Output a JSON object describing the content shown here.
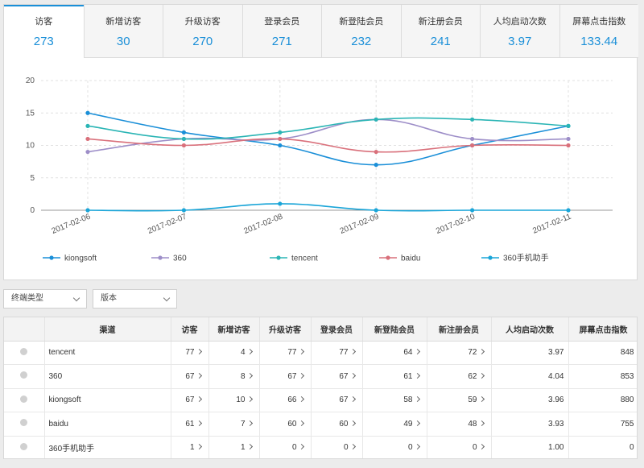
{
  "tabs": [
    {
      "label": "访客",
      "value": "273",
      "active": true
    },
    {
      "label": "新增访客",
      "value": "30"
    },
    {
      "label": "升级访客",
      "value": "270"
    },
    {
      "label": "登录会员",
      "value": "271"
    },
    {
      "label": "新登陆会员",
      "value": "232"
    },
    {
      "label": "新注册会员",
      "value": "241"
    },
    {
      "label": "人均启动次数",
      "value": "3.97"
    },
    {
      "label": "屏幕点击指数",
      "value": "133.44"
    }
  ],
  "chart_data": {
    "type": "line",
    "x": [
      "2017-02-06",
      "2017-02-07",
      "2017-02-08",
      "2017-02-09",
      "2017-02-10",
      "2017-02-11"
    ],
    "ylim": [
      0,
      20
    ],
    "yticks": [
      "0",
      "5",
      "10",
      "15",
      "20"
    ],
    "grid": true,
    "legend_position": "bottom",
    "series": [
      {
        "name": "kiongsoft",
        "color": "#1a8fd8",
        "values": [
          15,
          12,
          10,
          7,
          10,
          13
        ]
      },
      {
        "name": "360",
        "color": "#9d8ec8",
        "values": [
          9,
          11,
          11,
          14,
          11,
          11
        ]
      },
      {
        "name": "tencent",
        "color": "#2bb5b5",
        "values": [
          13,
          11,
          12,
          14,
          14,
          13
        ]
      },
      {
        "name": "baidu",
        "color": "#d9707b",
        "values": [
          11,
          10,
          11,
          9,
          10,
          10
        ]
      },
      {
        "name": "360手机助手",
        "color": "#1aa5d8",
        "values": [
          0,
          0,
          1,
          0,
          0,
          0
        ]
      }
    ]
  },
  "filters": {
    "terminal_type": "终端类型",
    "version": "版本"
  },
  "table": {
    "headers": [
      "",
      "渠道",
      "访客",
      "新增访客",
      "升级访客",
      "登录会员",
      "新登陆会员",
      "新注册会员",
      "人均启动次数",
      "屏幕点击指数"
    ],
    "rows": [
      {
        "name": "tencent",
        "cells": [
          "77",
          "4",
          "77",
          "77",
          "64",
          "72",
          "3.97",
          "848"
        ]
      },
      {
        "name": "360",
        "cells": [
          "67",
          "8",
          "67",
          "67",
          "61",
          "62",
          "4.04",
          "853"
        ]
      },
      {
        "name": "kiongsoft",
        "cells": [
          "67",
          "10",
          "66",
          "67",
          "58",
          "59",
          "3.96",
          "880"
        ]
      },
      {
        "name": "baidu",
        "cells": [
          "61",
          "7",
          "60",
          "60",
          "49",
          "48",
          "3.93",
          "755"
        ]
      },
      {
        "name": "360手机助手",
        "cells": [
          "1",
          "1",
          "0",
          "0",
          "0",
          "0",
          "1.00",
          "0"
        ]
      }
    ]
  }
}
